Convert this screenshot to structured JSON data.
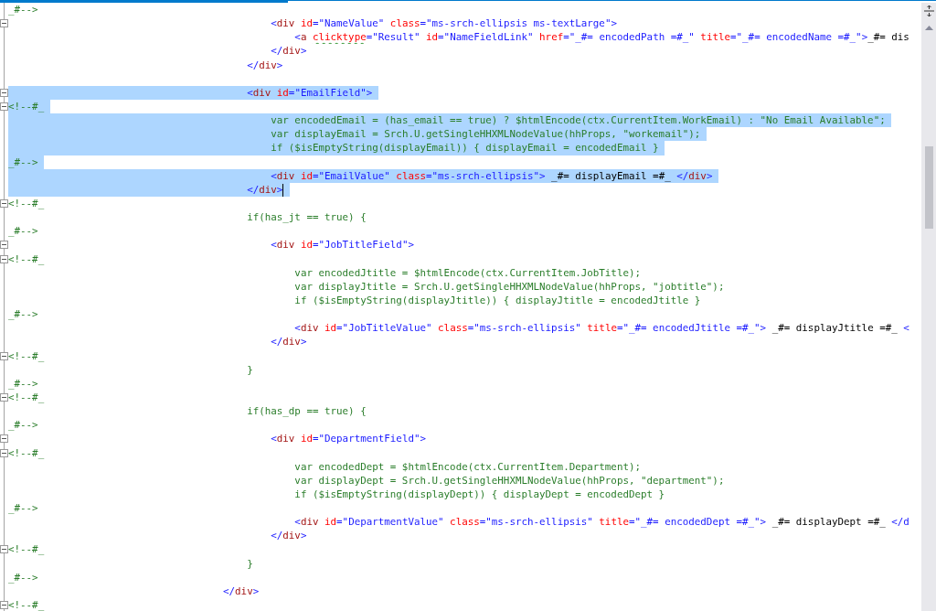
{
  "editor": {
    "lines": [
      {
        "selected": false,
        "fold_marker": false,
        "tokens": [
          {
            "kind": "script",
            "text": "_#-->"
          }
        ]
      },
      {
        "selected": false,
        "fold_marker": true,
        "tokens": [
          {
            "kind": "bracket",
            "text": "\t\t\t\t\t\t\t\t\t\t\t<"
          },
          {
            "kind": "tag",
            "text": "div"
          },
          {
            "kind": "attr",
            "text": " id"
          },
          {
            "kind": "bracket",
            "text": "="
          },
          {
            "kind": "value",
            "text": "\"NameValue\""
          },
          {
            "kind": "attr",
            "text": " class"
          },
          {
            "kind": "bracket",
            "text": "="
          },
          {
            "kind": "value",
            "text": "\"ms-srch-ellipsis ms-textLarge\""
          },
          {
            "kind": "bracket",
            "text": ">"
          }
        ]
      },
      {
        "selected": false,
        "fold_marker": false,
        "tokens": [
          {
            "kind": "bracket",
            "text": "\t\t\t\t\t\t\t\t\t\t\t\t<"
          },
          {
            "kind": "tag",
            "text": "a "
          },
          {
            "kind": "warning",
            "text": "clicktype"
          },
          {
            "kind": "bracket",
            "text": "="
          },
          {
            "kind": "value",
            "text": "\"Result\""
          },
          {
            "kind": "attr",
            "text": " id"
          },
          {
            "kind": "bracket",
            "text": "="
          },
          {
            "kind": "value",
            "text": "\"NameFieldLink\""
          },
          {
            "kind": "attr",
            "text": " href"
          },
          {
            "kind": "bracket",
            "text": "="
          },
          {
            "kind": "value",
            "text": "\"_#= encodedPath =#_\""
          },
          {
            "kind": "attr",
            "text": " title"
          },
          {
            "kind": "bracket",
            "text": "="
          },
          {
            "kind": "value",
            "text": "\"_#= encodedName =#_\">"
          },
          {
            "kind": "text",
            "text": "_#= dis"
          }
        ]
      },
      {
        "selected": false,
        "fold_marker": false,
        "tokens": [
          {
            "kind": "bracket",
            "text": "\t\t\t\t\t\t\t\t\t\t\t</"
          },
          {
            "kind": "tag",
            "text": "div"
          },
          {
            "kind": "bracket",
            "text": ">"
          }
        ]
      },
      {
        "selected": false,
        "fold_marker": false,
        "tokens": [
          {
            "kind": "bracket",
            "text": "\t\t\t\t\t\t\t\t\t\t</"
          },
          {
            "kind": "tag",
            "text": "div"
          },
          {
            "kind": "bracket",
            "text": ">"
          }
        ]
      },
      {
        "selected": false,
        "fold_marker": false
      },
      {
        "selected": true,
        "fold_marker": true,
        "tokens": [
          {
            "kind": "bracket",
            "text": "\t\t\t\t\t\t\t\t\t\t<"
          },
          {
            "kind": "tag",
            "text": "div"
          },
          {
            "kind": "attr",
            "text": " id"
          },
          {
            "kind": "bracket",
            "text": "="
          },
          {
            "kind": "value",
            "text": "\"EmailField\""
          },
          {
            "kind": "bracket",
            "text": ">"
          }
        ]
      },
      {
        "selected": true,
        "fold_marker": true,
        "tokens": [
          {
            "kind": "script",
            "text": "<!--#_"
          }
        ]
      },
      {
        "selected": true,
        "fold_marker": false,
        "tokens": [
          {
            "kind": "script",
            "text": "\t\t\t\t\t\t\t\t\t\t\tvar encodedEmail = (has_email == true) ? $htmlEncode(ctx.CurrentItem.WorkEmail) : \"No Email Available\";"
          }
        ]
      },
      {
        "selected": true,
        "fold_marker": false,
        "tokens": [
          {
            "kind": "script",
            "text": "\t\t\t\t\t\t\t\t\t\t\tvar displayEmail = Srch.U.getSingleHHXMLNodeValue(hhProps, \"workemail\");"
          }
        ]
      },
      {
        "selected": true,
        "fold_marker": false,
        "tokens": [
          {
            "kind": "script",
            "text": "\t\t\t\t\t\t\t\t\t\t\tif ($isEmptyString(displayEmail)) { displayEmail = encodedEmail }"
          }
        ]
      },
      {
        "selected": true,
        "fold_marker": false,
        "tokens": [
          {
            "kind": "script",
            "text": "_#-->"
          }
        ]
      },
      {
        "selected": true,
        "fold_marker": false,
        "tokens": [
          {
            "kind": "bracket",
            "text": "\t\t\t\t\t\t\t\t\t\t\t<"
          },
          {
            "kind": "tag",
            "text": "div"
          },
          {
            "kind": "attr",
            "text": " id"
          },
          {
            "kind": "bracket",
            "text": "="
          },
          {
            "kind": "value",
            "text": "\"EmailValue\""
          },
          {
            "kind": "attr",
            "text": " class"
          },
          {
            "kind": "bracket",
            "text": "="
          },
          {
            "kind": "value",
            "text": "\"ms-srch-ellipsis\""
          },
          {
            "kind": "bracket",
            "text": ">"
          },
          {
            "kind": "text",
            "text": " _#= displayEmail =#_ "
          },
          {
            "kind": "bracket",
            "text": "</"
          },
          {
            "kind": "tag",
            "text": "div"
          },
          {
            "kind": "bracket",
            "text": ">"
          }
        ]
      },
      {
        "selected": true,
        "fold_marker": false,
        "caret": true,
        "tokens": [
          {
            "kind": "bracket",
            "text": "\t\t\t\t\t\t\t\t\t\t</"
          },
          {
            "kind": "tag",
            "text": "div"
          },
          {
            "kind": "bracket",
            "text": ">"
          }
        ]
      },
      {
        "selected": false,
        "fold_marker": true,
        "tokens": [
          {
            "kind": "script",
            "text": "<!--#_"
          }
        ]
      },
      {
        "selected": false,
        "fold_marker": false,
        "tokens": [
          {
            "kind": "script",
            "text": "\t\t\t\t\t\t\t\t\t\tif(has_jt == true) {"
          }
        ]
      },
      {
        "selected": false,
        "fold_marker": false,
        "tokens": [
          {
            "kind": "script",
            "text": "_#-->"
          }
        ]
      },
      {
        "selected": false,
        "fold_marker": true,
        "tokens": [
          {
            "kind": "bracket",
            "text": "\t\t\t\t\t\t\t\t\t\t\t<"
          },
          {
            "kind": "tag",
            "text": "div"
          },
          {
            "kind": "attr",
            "text": " id"
          },
          {
            "kind": "bracket",
            "text": "="
          },
          {
            "kind": "value",
            "text": "\"JobTitleField\""
          },
          {
            "kind": "bracket",
            "text": ">"
          }
        ]
      },
      {
        "selected": false,
        "fold_marker": true,
        "tokens": [
          {
            "kind": "script",
            "text": "<!--#_"
          }
        ]
      },
      {
        "selected": false,
        "fold_marker": false,
        "tokens": [
          {
            "kind": "script",
            "text": "\t\t\t\t\t\t\t\t\t\t\t\tvar encodedJtitle = $htmlEncode(ctx.CurrentItem.JobTitle);"
          }
        ]
      },
      {
        "selected": false,
        "fold_marker": false,
        "tokens": [
          {
            "kind": "script",
            "text": "\t\t\t\t\t\t\t\t\t\t\t\tvar displayJtitle = Srch.U.getSingleHHXMLNodeValue(hhProps, \"jobtitle\");"
          }
        ]
      },
      {
        "selected": false,
        "fold_marker": false,
        "tokens": [
          {
            "kind": "script",
            "text": "\t\t\t\t\t\t\t\t\t\t\t\tif ($isEmptyString(displayJtitle)) { displayJtitle = encodedJtitle }"
          }
        ]
      },
      {
        "selected": false,
        "fold_marker": false,
        "tokens": [
          {
            "kind": "script",
            "text": "_#-->"
          }
        ]
      },
      {
        "selected": false,
        "fold_marker": false,
        "tokens": [
          {
            "kind": "bracket",
            "text": "\t\t\t\t\t\t\t\t\t\t\t\t<"
          },
          {
            "kind": "tag",
            "text": "div"
          },
          {
            "kind": "attr",
            "text": " id"
          },
          {
            "kind": "bracket",
            "text": "="
          },
          {
            "kind": "value",
            "text": "\"JobTitleValue\""
          },
          {
            "kind": "attr",
            "text": " class"
          },
          {
            "kind": "bracket",
            "text": "="
          },
          {
            "kind": "value",
            "text": "\"ms-srch-ellipsis\""
          },
          {
            "kind": "attr",
            "text": " title"
          },
          {
            "kind": "bracket",
            "text": "="
          },
          {
            "kind": "value",
            "text": "\"_#= encodedJtitle =#_\">"
          },
          {
            "kind": "text",
            "text": " _#= displayJtitle =#_ "
          },
          {
            "kind": "bracket",
            "text": "<"
          }
        ]
      },
      {
        "selected": false,
        "fold_marker": false,
        "tokens": [
          {
            "kind": "bracket",
            "text": "\t\t\t\t\t\t\t\t\t\t\t</"
          },
          {
            "kind": "tag",
            "text": "div"
          },
          {
            "kind": "bracket",
            "text": ">"
          }
        ]
      },
      {
        "selected": false,
        "fold_marker": true,
        "tokens": [
          {
            "kind": "script",
            "text": "<!--#_"
          }
        ]
      },
      {
        "selected": false,
        "fold_marker": false,
        "tokens": [
          {
            "kind": "script",
            "text": "\t\t\t\t\t\t\t\t\t\t}"
          }
        ]
      },
      {
        "selected": false,
        "fold_marker": false,
        "tokens": [
          {
            "kind": "script",
            "text": "_#-->"
          }
        ]
      },
      {
        "selected": false,
        "fold_marker": true,
        "tokens": [
          {
            "kind": "script",
            "text": "<!--#_"
          }
        ]
      },
      {
        "selected": false,
        "fold_marker": false,
        "tokens": [
          {
            "kind": "script",
            "text": "\t\t\t\t\t\t\t\t\t\tif(has_dp == true) {"
          }
        ]
      },
      {
        "selected": false,
        "fold_marker": false,
        "tokens": [
          {
            "kind": "script",
            "text": "_#-->"
          }
        ]
      },
      {
        "selected": false,
        "fold_marker": true,
        "tokens": [
          {
            "kind": "bracket",
            "text": "\t\t\t\t\t\t\t\t\t\t\t<"
          },
          {
            "kind": "tag",
            "text": "div"
          },
          {
            "kind": "attr",
            "text": " id"
          },
          {
            "kind": "bracket",
            "text": "="
          },
          {
            "kind": "value",
            "text": "\"DepartmentField\""
          },
          {
            "kind": "bracket",
            "text": ">"
          }
        ]
      },
      {
        "selected": false,
        "fold_marker": true,
        "tokens": [
          {
            "kind": "script",
            "text": "<!--#_"
          }
        ]
      },
      {
        "selected": false,
        "fold_marker": false,
        "tokens": [
          {
            "kind": "script",
            "text": "\t\t\t\t\t\t\t\t\t\t\t\tvar encodedDept = $htmlEncode(ctx.CurrentItem.Department);"
          }
        ]
      },
      {
        "selected": false,
        "fold_marker": false,
        "tokens": [
          {
            "kind": "script",
            "text": "\t\t\t\t\t\t\t\t\t\t\t\tvar displayDept = Srch.U.getSingleHHXMLNodeValue(hhProps, \"department\");"
          }
        ]
      },
      {
        "selected": false,
        "fold_marker": false,
        "tokens": [
          {
            "kind": "script",
            "text": "\t\t\t\t\t\t\t\t\t\t\t\tif ($isEmptyString(displayDept)) { displayDept = encodedDept }"
          }
        ]
      },
      {
        "selected": false,
        "fold_marker": false,
        "tokens": [
          {
            "kind": "script",
            "text": "_#-->"
          }
        ]
      },
      {
        "selected": false,
        "fold_marker": false,
        "tokens": [
          {
            "kind": "bracket",
            "text": "\t\t\t\t\t\t\t\t\t\t\t\t<"
          },
          {
            "kind": "tag",
            "text": "div"
          },
          {
            "kind": "attr",
            "text": " id"
          },
          {
            "kind": "bracket",
            "text": "="
          },
          {
            "kind": "value",
            "text": "\"DepartmentValue\""
          },
          {
            "kind": "attr",
            "text": " class"
          },
          {
            "kind": "bracket",
            "text": "="
          },
          {
            "kind": "value",
            "text": "\"ms-srch-ellipsis\""
          },
          {
            "kind": "attr",
            "text": " title"
          },
          {
            "kind": "bracket",
            "text": "="
          },
          {
            "kind": "value",
            "text": "\"_#= encodedDept =#_\">"
          },
          {
            "kind": "text",
            "text": " _#= displayDept =#_ "
          },
          {
            "kind": "bracket",
            "text": "</d"
          }
        ]
      },
      {
        "selected": false,
        "fold_marker": false,
        "tokens": [
          {
            "kind": "bracket",
            "text": "\t\t\t\t\t\t\t\t\t\t\t</"
          },
          {
            "kind": "tag",
            "text": "div"
          },
          {
            "kind": "bracket",
            "text": ">"
          }
        ]
      },
      {
        "selected": false,
        "fold_marker": true,
        "tokens": [
          {
            "kind": "script",
            "text": "<!--#_"
          }
        ]
      },
      {
        "selected": false,
        "fold_marker": false,
        "tokens": [
          {
            "kind": "script",
            "text": "\t\t\t\t\t\t\t\t\t\t}"
          }
        ]
      },
      {
        "selected": false,
        "fold_marker": false,
        "tokens": [
          {
            "kind": "script",
            "text": "_#-->"
          }
        ]
      },
      {
        "selected": false,
        "fold_marker": false,
        "tokens": [
          {
            "kind": "bracket",
            "text": "\t\t\t\t\t\t\t\t\t</"
          },
          {
            "kind": "tag",
            "text": "div"
          },
          {
            "kind": "bracket",
            "text": ">"
          }
        ]
      },
      {
        "selected": false,
        "fold_marker": true,
        "tokens": [
          {
            "kind": "script",
            "text": "<!--#_"
          }
        ]
      }
    ]
  }
}
